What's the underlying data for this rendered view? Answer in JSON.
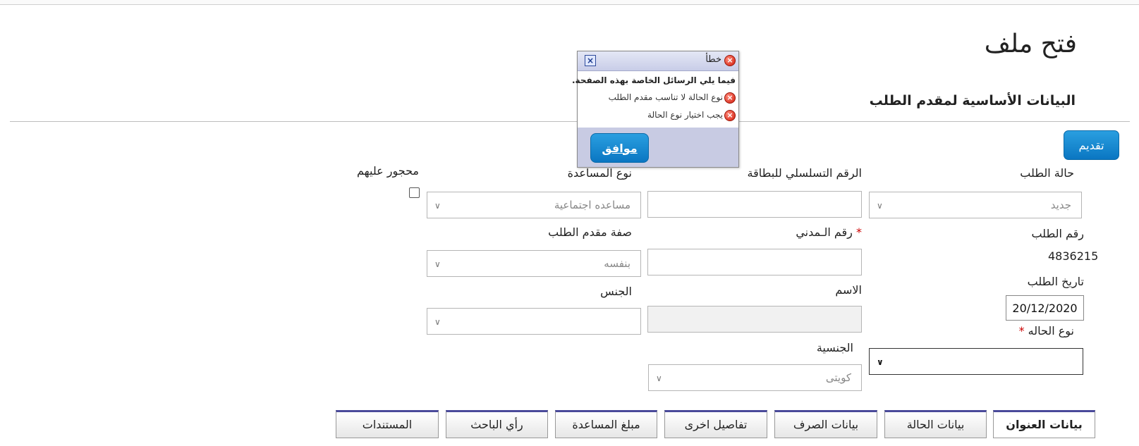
{
  "page": {
    "title": "فتح ملف",
    "section_title": "البيانات الأساسية لمقدم الطلب",
    "submit_label": "تقديم"
  },
  "form": {
    "request_status": {
      "label": "حالة الطلب",
      "value": "جديد"
    },
    "card_serial": {
      "label": "الرقم التسلسلي للبطاقة",
      "value": ""
    },
    "assistance_type": {
      "label": "نوع المساعدة",
      "value": "مساعده اجتماعية"
    },
    "restricted": {
      "label": "محجور عليهم"
    },
    "request_number": {
      "label": "رقم الطلب",
      "value": "4836215"
    },
    "civil_id": {
      "label": "رقم الـمدني",
      "required_mark": "*",
      "value": ""
    },
    "applicant_capacity": {
      "label": "صفة مقدم الطلب",
      "value": "بنفسه"
    },
    "request_date": {
      "label": "تاريخ الطلب",
      "value": "20/12/2020"
    },
    "name": {
      "label": "الاسم",
      "value": ""
    },
    "gender": {
      "label": "الجنس",
      "value": ""
    },
    "case_type": {
      "label": "نوع الحاله",
      "required_mark": "*",
      "value": ""
    },
    "nationality": {
      "label": "الجنسية",
      "value": "كويتى"
    }
  },
  "tabs": [
    "بيانات العنوان",
    "بيانات الحالة",
    "بيانات الصرف",
    "تفاصيل اخرى",
    "مبلغ المساعدة",
    "رأي الباحث",
    "المستندات"
  ],
  "dialog": {
    "title": "خطأ",
    "heading": "فيما يلي الرسائل الخاصة بهذه الصفحة.",
    "messages": [
      "نوع الحالة لا تناسب مقدم الطلب",
      "يجب اختيار نوع الحالة"
    ],
    "ok_label": "موافق"
  },
  "icons": {
    "error": "error-icon",
    "close": "close-icon",
    "chevron": "chevron-down-icon"
  }
}
